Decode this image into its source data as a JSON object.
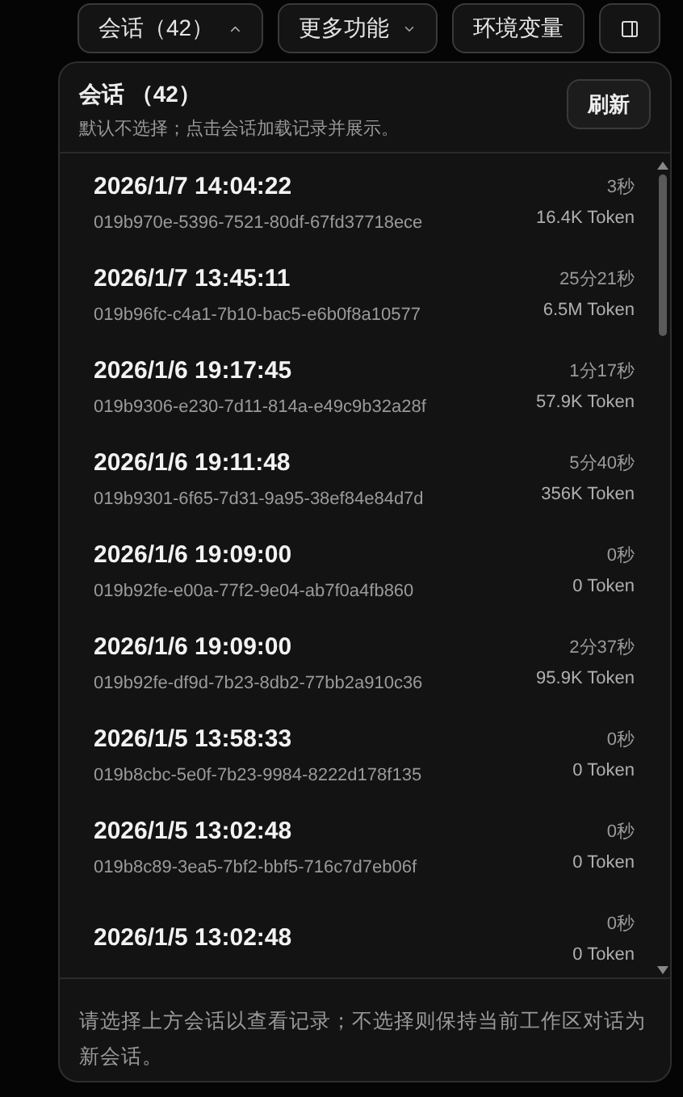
{
  "toolbar": {
    "sessions_button": {
      "label": "会话（42）",
      "expanded": true
    },
    "more_button": {
      "label": "更多功能",
      "expanded": false
    },
    "env_button": {
      "label": "环境变量"
    }
  },
  "panel": {
    "title": "会话 （42）",
    "subtitle": "默认不选择；点击会话加载记录并展示。",
    "refresh_button": "刷新",
    "sessions": [
      {
        "date": "2026/1/7 14:04:22",
        "id": "019b970e-5396-7521-80df-67fd37718ece",
        "duration": "3秒",
        "tokens": "16.4K Token"
      },
      {
        "date": "2026/1/7 13:45:11",
        "id": "019b96fc-c4a1-7b10-bac5-e6b0f8a10577",
        "duration": "25分21秒",
        "tokens": "6.5M Token"
      },
      {
        "date": "2026/1/6 19:17:45",
        "id": "019b9306-e230-7d11-814a-e49c9b32a28f",
        "duration": "1分17秒",
        "tokens": "57.9K Token"
      },
      {
        "date": "2026/1/6 19:11:48",
        "id": "019b9301-6f65-7d31-9a95-38ef84e84d7d",
        "duration": "5分40秒",
        "tokens": "356K Token"
      },
      {
        "date": "2026/1/6 19:09:00",
        "id": "019b92fe-e00a-77f2-9e04-ab7f0a4fb860",
        "duration": "0秒",
        "tokens": "0 Token"
      },
      {
        "date": "2026/1/6 19:09:00",
        "id": "019b92fe-df9d-7b23-8db2-77bb2a910c36",
        "duration": "2分37秒",
        "tokens": "95.9K Token"
      },
      {
        "date": "2026/1/5 13:58:33",
        "id": "019b8cbc-5e0f-7b23-9984-8222d178f135",
        "duration": "0秒",
        "tokens": "0 Token"
      },
      {
        "date": "2026/1/5 13:02:48",
        "id": "019b8c89-3ea5-7bf2-bbf5-716c7d7eb06f",
        "duration": "0秒",
        "tokens": "0 Token"
      },
      {
        "date": "2026/1/5 13:02:48",
        "duration": "0秒",
        "tokens": "0 Token"
      }
    ],
    "footer": "请选择上方会话以查看记录；不选择则保持当前工作区对话为新会话。"
  }
}
